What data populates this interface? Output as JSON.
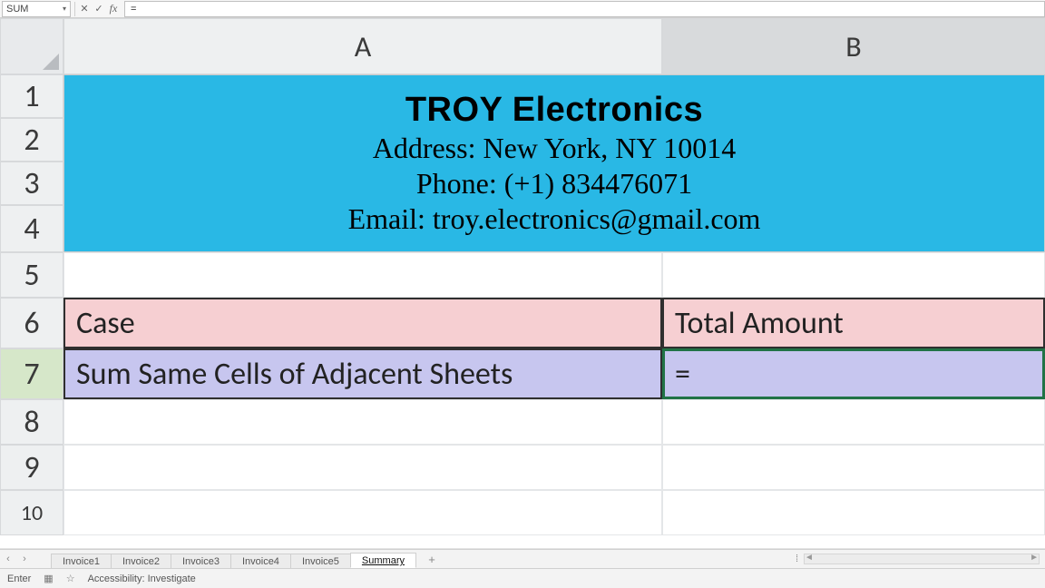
{
  "formula_bar": {
    "name_box": "SUM",
    "cancel_glyph": "✕",
    "enter_glyph": "✓",
    "fx_glyph": "fx",
    "formula_text": "="
  },
  "columns": {
    "A": "A",
    "B": "B"
  },
  "rows": [
    "1",
    "2",
    "3",
    "4",
    "5",
    "6",
    "7",
    "8",
    "9",
    "10"
  ],
  "banner": {
    "title": "TROY Electronics",
    "address": "Address: New York, NY 10014",
    "phone": "Phone: (+1) 834476071",
    "email": "Email: troy.electronics@gmail.com"
  },
  "table": {
    "header_case": "Case",
    "header_total": "Total Amount",
    "row_case": "Sum Same Cells of Adjacent Sheets",
    "row_total": "="
  },
  "tabs": {
    "items": [
      "Invoice1",
      "Invoice2",
      "Invoice3",
      "Invoice4",
      "Invoice5",
      "Summary"
    ],
    "active_index": 5,
    "add_glyph": "+",
    "prev_glyph": "‹",
    "next_glyph": "›"
  },
  "status": {
    "mode": "Enter",
    "accessibility": "Accessibility: Investigate",
    "grid_icon": "▦",
    "star_icon": "☆"
  }
}
